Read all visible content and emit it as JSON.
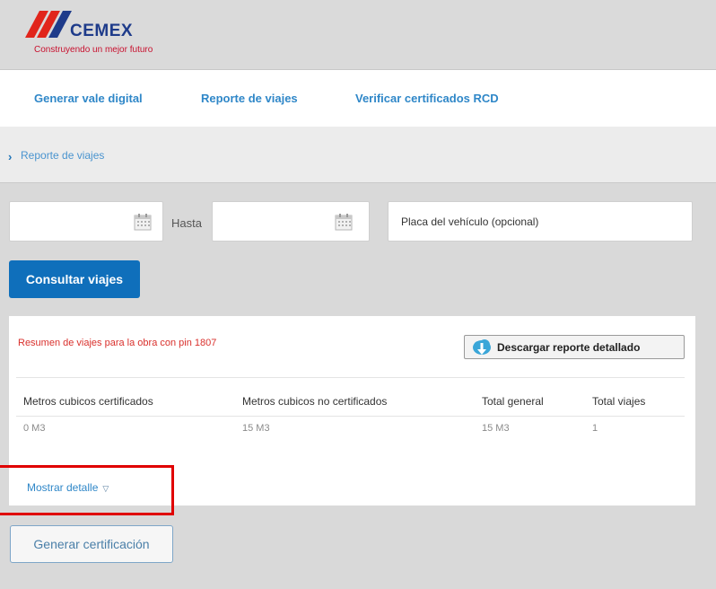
{
  "brand": {
    "name": "CEMEX",
    "tagline": "Construyendo un mejor futuro",
    "colors": {
      "red": "#e1251b",
      "blue": "#1e3b8a",
      "accent": "#0f6fbb"
    }
  },
  "nav": {
    "items": [
      {
        "label": "Generar vale digital"
      },
      {
        "label": "Reporte de viajes"
      },
      {
        "label": "Verificar certificados RCD"
      }
    ]
  },
  "breadcrumb": {
    "icon": "chevron-right-icon",
    "label": "Reporte de viajes"
  },
  "filters": {
    "date_from": {
      "value": "",
      "icon": "calendar-icon"
    },
    "separator": "Hasta",
    "date_to": {
      "value": "",
      "icon": "calendar-icon"
    },
    "plate": {
      "placeholder": "Placa del vehículo (opcional)"
    },
    "submit_label": "Consultar viajes"
  },
  "summary": {
    "title": "Resumen de viajes para la obra con pin 1807",
    "download": {
      "label": "Descargar reporte detallado",
      "icon": "cloud-download-icon"
    },
    "columns": [
      "Metros cubicos certificados",
      "Metros cubicos no certificados",
      "Total general",
      "Total viajes"
    ],
    "row": [
      "0 M3",
      "15 M3",
      "15 M3",
      "1"
    ],
    "toggle": {
      "label": "Mostrar detalle",
      "icon": "triangle-down-icon"
    }
  },
  "actions": {
    "certify_label": "Generar certificación"
  }
}
